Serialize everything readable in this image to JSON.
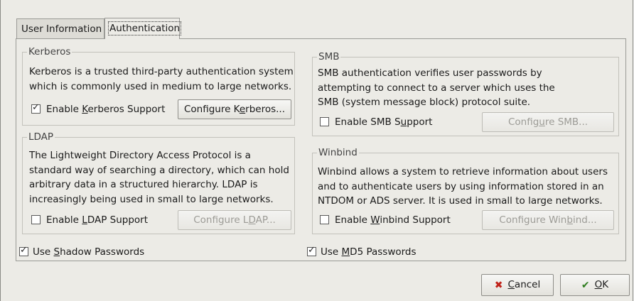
{
  "tabs": [
    {
      "label": "User Information"
    },
    {
      "label": "Authentication"
    }
  ],
  "kerberos": {
    "title": "Kerberos",
    "desc_lines": [
      "Kerberos is a trusted third-party authentication system",
      "which is commonly used in medium to large networks."
    ],
    "enable_pre": "Enable ",
    "enable_mn": "K",
    "enable_post": "erberos Support",
    "enabled": true,
    "configure_pre": "Configure K",
    "configure_mn": "e",
    "configure_post": "rberos..."
  },
  "ldap": {
    "title": "LDAP",
    "desc_lines": [
      "The Lightweight Directory Access Protocol is a",
      "standard way of searching a directory, which can hold",
      "arbitrary data in a structured hierarchy.  LDAP is",
      "increasingly being used in small to large networks."
    ],
    "enable_pre": "Enable ",
    "enable_mn": "L",
    "enable_post": "DAP Support",
    "enabled": false,
    "configure_pre": "Configure L",
    "configure_mn": "D",
    "configure_post": "AP..."
  },
  "smb": {
    "title": "SMB",
    "desc_lines": [
      "SMB authentication verifies user passwords by",
      "attempting to connect to a server which uses the",
      "SMB (system message block) protocol suite."
    ],
    "enable_pre": "Enable SMB S",
    "enable_mn": "u",
    "enable_post": "pport",
    "enabled": false,
    "configure_pre": "Config",
    "configure_mn": "u",
    "configure_post": "re SMB..."
  },
  "winbind": {
    "title": "Winbind",
    "desc_lines": [
      "Winbind allows a system to retrieve information about users",
      "and to authenticate users by using information stored in an",
      "NTDOM or ADS server.  It is used in small to large networks."
    ],
    "enable_pre": "Enable ",
    "enable_mn": "W",
    "enable_post": "inbind Support",
    "enabled": false,
    "configure_pre": "Configure Win",
    "configure_mn": "b",
    "configure_post": "ind..."
  },
  "shadow": {
    "pre": "Use ",
    "mn": "S",
    "post": "hadow Passwords",
    "checked": true
  },
  "md5": {
    "pre": "Use ",
    "mn": "M",
    "post": "D5 Passwords",
    "checked": true
  },
  "buttons": {
    "cancel_mn": "C",
    "cancel_post": "ancel",
    "ok_mn": "O",
    "ok_post": "K"
  },
  "icons": {
    "cancel": "cancel-icon",
    "ok": "ok-icon"
  },
  "colors": {
    "cancel_icon": "#c0231a",
    "ok_icon": "#2e7d1e"
  }
}
